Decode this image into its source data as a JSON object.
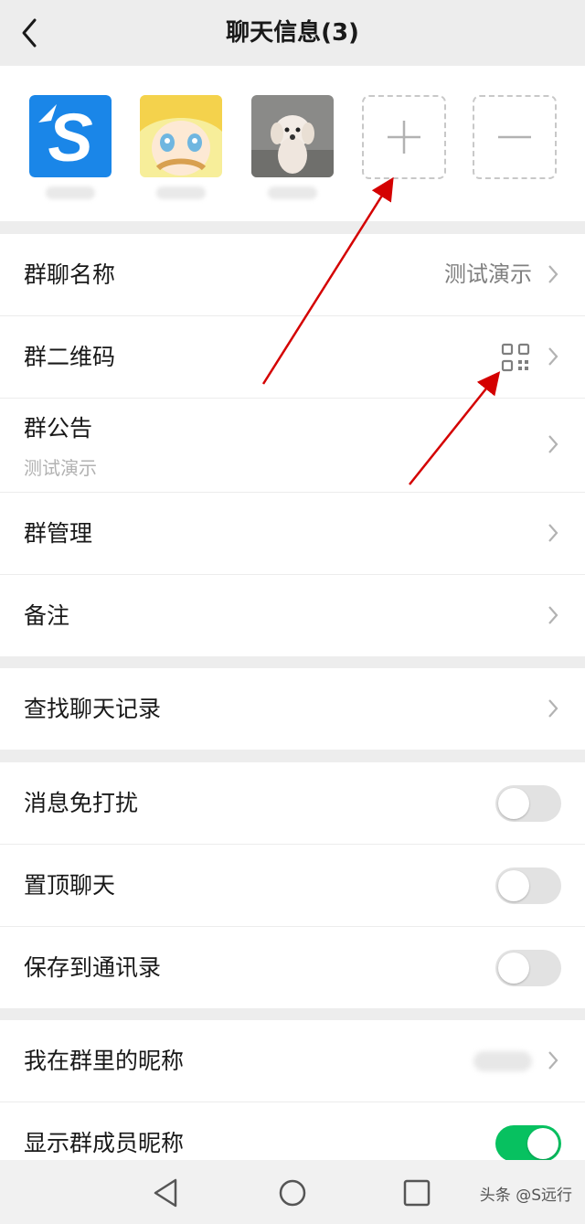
{
  "header": {
    "title": "聊天信息(3)"
  },
  "members": [
    {
      "name": "",
      "avatar": "blue-s-logo"
    },
    {
      "name": "",
      "avatar": "anime-character"
    },
    {
      "name": "",
      "avatar": "white-dog-photo"
    }
  ],
  "member_actions": {
    "add": "+",
    "remove": "−"
  },
  "group_settings": {
    "name_label": "群聊名称",
    "name_value": "测试演示",
    "qrcode_label": "群二维码",
    "notice_label": "群公告",
    "notice_value": "测试演示",
    "manage_label": "群管理",
    "remark_label": "备注"
  },
  "search": {
    "label": "查找聊天记录"
  },
  "toggles": {
    "mute_label": "消息免打扰",
    "mute_on": false,
    "pin_label": "置顶聊天",
    "pin_on": false,
    "save_label": "保存到通讯录",
    "save_on": false
  },
  "nickname": {
    "my_nickname_label": "我在群里的昵称",
    "show_nickname_label": "显示群成员昵称",
    "show_nickname_on": true
  },
  "watermark": "头条 @S远行",
  "colors": {
    "accent": "#07c160",
    "annotation_arrow": "#d40000"
  }
}
